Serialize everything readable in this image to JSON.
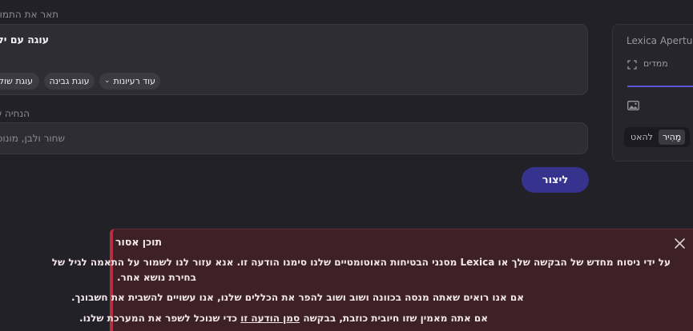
{
  "prompt": {
    "label": "תאר את התמונה",
    "text": "עוגה עם ילדים",
    "chips": [
      {
        "label": "עוד רעיונות",
        "icon": "chevron-down-icon"
      },
      {
        "label": "עוגת גבינה"
      },
      {
        "label": "עוגת שוקולד"
      }
    ]
  },
  "negative": {
    "label": "הנחיה שלילית",
    "placeholder": "שחור ולבן, מונוכרום"
  },
  "actions": {
    "create_label": "ליצור"
  },
  "side_panel": {
    "model": "Lexica Aperture",
    "advanced_label": "ממדים",
    "mode_options": [
      "מָהִיר",
      "להאט"
    ],
    "active_mode": "מָהִיר"
  },
  "alert": {
    "title": "תוכן אסור",
    "line1": "על ידי ניסוח מחדש של הבקשה שלך או Lexica מסנני הבטיחות האוטומטיים שלנו סימנו הודעה זו. אנא עזור לנו לשמור על התאמה לגיל של",
    "line1_cont": "בחירת נושא אחר.",
    "line2": "אם אנו רואים שאתה מנסה בכוונה ושוב ושוב להפר את הכללים שלנו, אנו עשויים להשבית את חשבונך.",
    "line3_pre": "אם אתה מאמין שזו חיובית כוזבת, בבקשה",
    "line3_link": "סמן הודעה זו",
    "line3_post": "כדי שנוכל לשפר את המערכת שלנו."
  },
  "colors": {
    "background": "#222127",
    "accent": "#36338f",
    "alert_bg": "#3d2127",
    "alert_border": "#b3323d"
  }
}
